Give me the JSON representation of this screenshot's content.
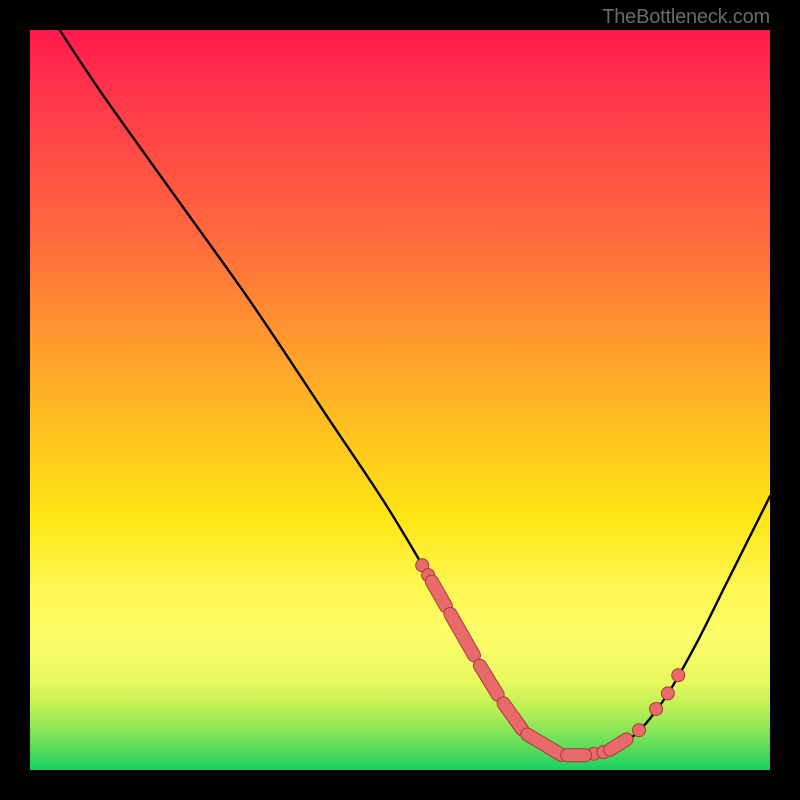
{
  "attribution": "TheBottleneck.com",
  "colors": {
    "marker_fill": "#e96a6a",
    "marker_stroke": "#a83a3a",
    "curve_stroke": "#000000"
  },
  "chart_data": {
    "type": "line",
    "title": "",
    "xlabel": "",
    "ylabel": "",
    "xlim": [
      0,
      100
    ],
    "ylim": [
      0,
      100
    ],
    "grid": false,
    "series": [
      {
        "name": "curve",
        "x": [
          4,
          10,
          20,
          30,
          40,
          48,
          54,
          58,
          62,
          66,
          68,
          70,
          72,
          75,
          78,
          82,
          86,
          90,
          94,
          98,
          100
        ],
        "y": [
          100,
          91,
          77,
          63,
          48,
          36,
          26,
          19,
          12,
          6,
          4,
          2.5,
          2,
          2,
          2.5,
          5,
          10,
          17,
          25,
          33,
          37
        ]
      }
    ],
    "markers": {
      "pills": [
        {
          "along_x": [
            54.3,
            56.2
          ],
          "note": "upper-left cluster"
        },
        {
          "along_x": [
            56.8,
            60.0
          ]
        },
        {
          "along_x": [
            60.8,
            63.2
          ]
        },
        {
          "along_x": [
            64.0,
            66.5
          ]
        },
        {
          "along_x": [
            67.2,
            71.8
          ],
          "note": "bottom cluster long"
        },
        {
          "along_x": [
            72.6,
            75.0
          ]
        },
        {
          "along_x": [
            78.4,
            80.6
          ]
        }
      ],
      "dots": [
        {
          "at_x": 53.0
        },
        {
          "at_x": 53.8
        },
        {
          "at_x": 76.2
        },
        {
          "at_x": 77.5
        },
        {
          "at_x": 84.6
        },
        {
          "at_x": 86.2
        },
        {
          "at_x": 87.6
        },
        {
          "at_x": 82.3
        }
      ]
    }
  }
}
